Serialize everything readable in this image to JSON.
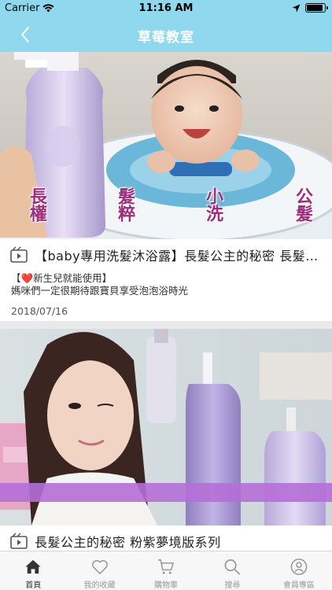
{
  "status": {
    "carrier": "Carrier",
    "time": "11:16 AM",
    "battery_level": 0.9
  },
  "nav": {
    "title": "草莓教室",
    "back_icon": "chevron-left-icon"
  },
  "colors": {
    "nav_bg": "#8fd8ee",
    "accent_purple": "#b56fd6",
    "heart_red": "#e02d3c"
  },
  "videos": [
    {
      "title": "【baby專用洗髮沐浴露】長髮公主的秘密 長髮公主",
      "desc_line1": "【❤️新生兒就能使用】",
      "desc_line2": "媽咪們一定很期待跟寶貝享受泡泡浴時光",
      "date": "2018/07/16",
      "captions": [
        "長權",
        "髮粹",
        "小洗",
        "公髮"
      ]
    },
    {
      "title": "長髮公主的秘密 粉紫夢境版系列"
    }
  ],
  "tabs": [
    {
      "label": "首頁",
      "icon": "home-icon",
      "active": true
    },
    {
      "label": "我的收藏",
      "icon": "heart-icon",
      "active": false
    },
    {
      "label": "購物車",
      "icon": "cart-icon",
      "active": false
    },
    {
      "label": "搜尋",
      "icon": "search-icon",
      "active": false
    },
    {
      "label": "會員專區",
      "icon": "user-icon",
      "active": false
    }
  ]
}
